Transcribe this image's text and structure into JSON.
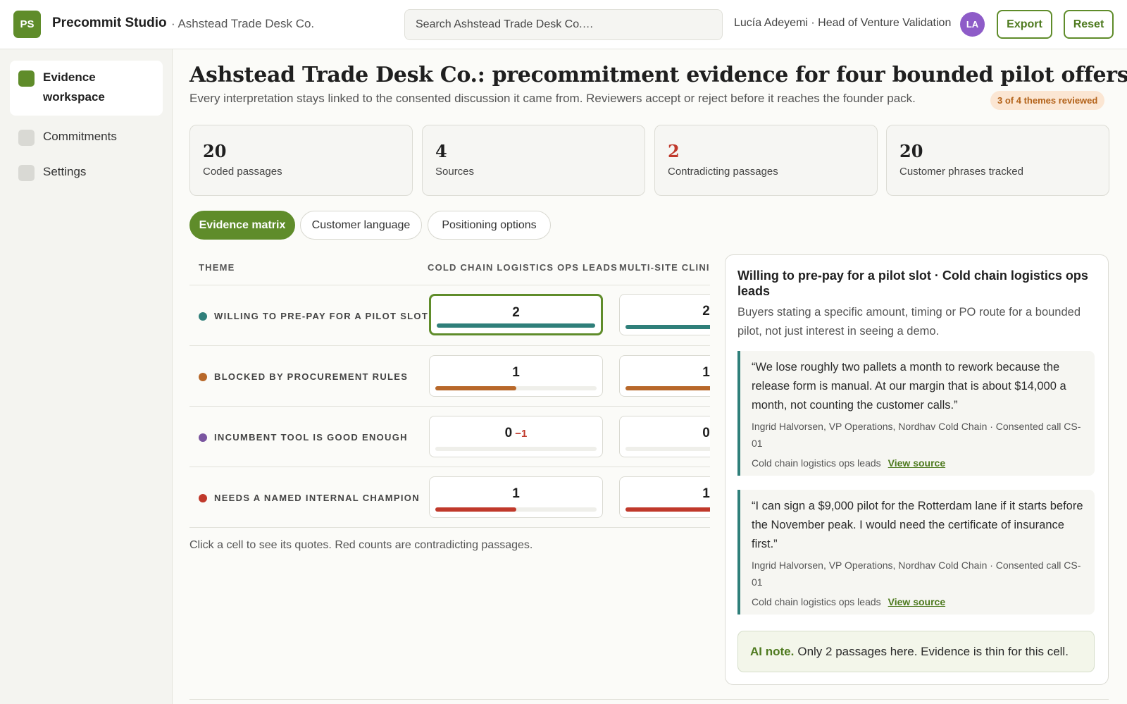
{
  "header": {
    "logo_initials": "PS",
    "app_name": "Precommit Studio",
    "org_name": "· Ashstead Trade Desk Co.",
    "search_placeholder": "Search Ashstead Trade Desk Co.…",
    "user": "Lucía Adeyemi · Head of Venture Validation",
    "avatar_initials": "LA",
    "export_label": "Export",
    "reset_label": "Reset"
  },
  "sidebar": {
    "items": [
      {
        "label": "Evidence workspace",
        "active": true
      },
      {
        "label": "Commitments",
        "active": false
      },
      {
        "label": "Settings",
        "active": false
      }
    ]
  },
  "page": {
    "title": "Ashstead Trade Desk Co.: precommitment evidence for four bounded pilot offers",
    "subtitle": "Every interpretation stays linked to the consented discussion it came from. Reviewers accept or reject before it reaches the founder pack.",
    "review_badge": "3 of 4 themes reviewed"
  },
  "stats": [
    {
      "value": "20",
      "label": "Coded passages",
      "warn": false
    },
    {
      "value": "4",
      "label": "Sources",
      "warn": false
    },
    {
      "value": "2",
      "label": "Contradicting passages",
      "warn": true
    },
    {
      "value": "20",
      "label": "Customer phrases tracked",
      "warn": false
    }
  ],
  "tabs": [
    {
      "label": "Evidence matrix",
      "active": true
    },
    {
      "label": "Customer language",
      "active": false
    },
    {
      "label": "Positioning options",
      "active": false
    }
  ],
  "matrix": {
    "headers": [
      "THEME",
      "COLD CHAIN LOGISTICS OPS LEADS",
      "MULTI-SITE CLINIC"
    ],
    "rows": [
      {
        "theme": "WILLING TO PRE-PAY FOR A PILOT SLOT",
        "color": "#2f7f7a",
        "cells": [
          {
            "value": "2",
            "neg": "",
            "fill": 1.0
          },
          {
            "value": "2",
            "neg": "",
            "fill": 1.0
          }
        ]
      },
      {
        "theme": "BLOCKED BY PROCUREMENT RULES",
        "color": "#b8682a",
        "cells": [
          {
            "value": "1",
            "neg": "",
            "fill": 0.5
          },
          {
            "value": "1",
            "neg": "",
            "fill": 1.0
          }
        ]
      },
      {
        "theme": "INCUMBENT TOOL IS GOOD ENOUGH",
        "color": "#7a55a0",
        "cells": [
          {
            "value": "0",
            "neg": "−1",
            "fill": 0
          },
          {
            "value": "0",
            "neg": "",
            "fill": 0
          }
        ]
      },
      {
        "theme": "NEEDS A NAMED INTERNAL CHAMPION",
        "color": "#c0392b",
        "cells": [
          {
            "value": "1",
            "neg": "",
            "fill": 0.5
          },
          {
            "value": "1",
            "neg": "",
            "fill": 1.0
          }
        ]
      }
    ],
    "note": "Click a cell to see its quotes. Red counts are contradicting passages."
  },
  "detail": {
    "title": "Willing to pre-pay for a pilot slot · Cold chain logistics ops leads",
    "description": "Buyers stating a specific amount, timing or PO route for a bounded pilot, not just interest in seeing a demo.",
    "quotes": [
      {
        "text": "“We lose roughly two pallets a month to rework because the release form is manual. At our margin that is about $14,000 a month, not counting the customer calls.”",
        "attribution": "Ingrid Halvorsen, VP Operations, Nordhav Cold Chain · Consented call CS-01",
        "segment": "Cold chain logistics ops leads",
        "link": "View source"
      },
      {
        "text": "“I can sign a $9,000 pilot for the Rotterdam lane if it starts before the November peak. I would need the certificate of insurance first.”",
        "attribution": "Ingrid Halvorsen, VP Operations, Nordhav Cold Chain · Consented call CS-01",
        "segment": "Cold chain logistics ops leads",
        "link": "View source"
      }
    ],
    "ai_label": "AI note.",
    "ai_text": "Only 2 passages here. Evidence is thin for this cell."
  }
}
